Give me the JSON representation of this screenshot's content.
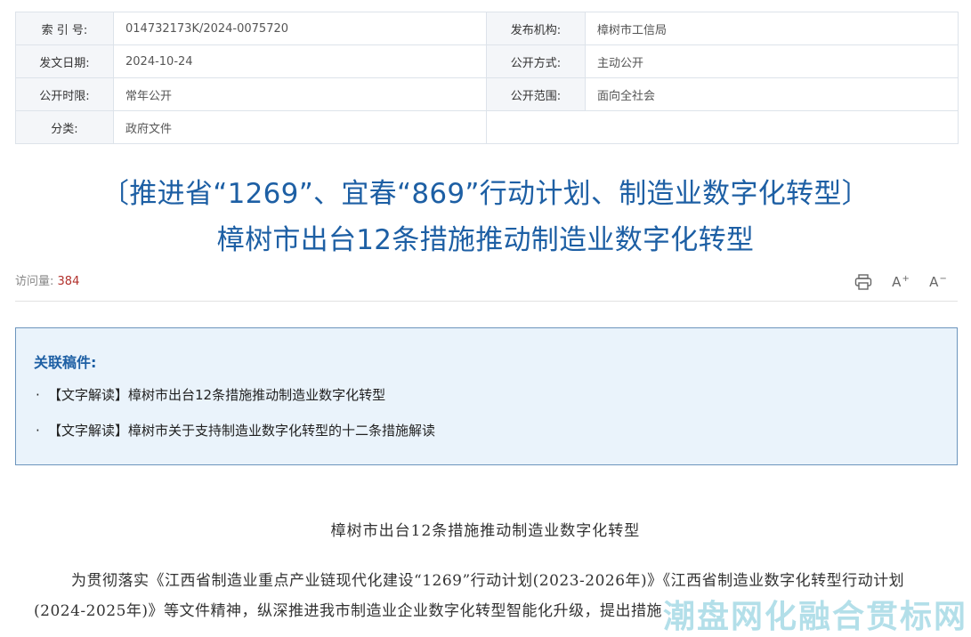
{
  "meta": {
    "index_label": "索 引 号:",
    "index_value": "014732173K/2024-0075720",
    "publisher_label": "发布机构:",
    "publisher_value": "樟树市工信局",
    "date_label": "发文日期:",
    "date_value": "2024-10-24",
    "open_mode_label": "公开方式:",
    "open_mode_value": "主动公开",
    "open_time_label": "公开时限:",
    "open_time_value": "常年公开",
    "open_scope_label": "公开范围:",
    "open_scope_value": "面向全社会",
    "category_label": "分类:",
    "category_value": "政府文件"
  },
  "title": {
    "line1": "〔推进省“1269”、宜春“869”行动计划、制造业数字化转型〕",
    "line2": "樟树市出台12条措施推动制造业数字化转型"
  },
  "visits": {
    "label": "访问量:",
    "count": "384"
  },
  "tools": {
    "print_icon": "print-icon",
    "font_larger": "A",
    "font_smaller": "A"
  },
  "related": {
    "heading": "关联稿件:",
    "items": [
      "【文字解读】樟树市出台12条措施推动制造业数字化转型",
      "【文字解读】樟树市关于支持制造业数字化转型的十二条措施解读"
    ]
  },
  "article": {
    "title": "樟树市出台12条措施推动制造业数字化转型",
    "paragraph": "为贯彻落实《江西省制造业重点产业链现代化建设“1269”行动计划(2023-2026年)》《江西省制造业数字化转型行动计划(2024-2025年)》等文件精神，纵深推进我市制造业企业数字化转型智能化升级，提出措施"
  },
  "watermark": "潮盘网化融合贯标网",
  "colors": {
    "title_blue": "#1d5fa4",
    "count_red": "#b2312c",
    "box_bg": "#eaf3fb"
  }
}
